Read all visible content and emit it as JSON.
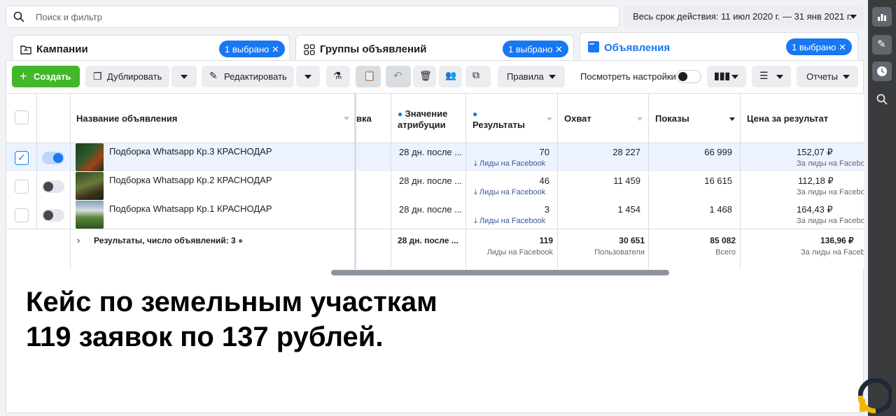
{
  "search": {
    "placeholder": "Поиск и фильтр"
  },
  "date_range": "Весь срок действия: 11 июл 2020 г. — 31 янв 2021 г.",
  "tabs": [
    {
      "label": "Кампании",
      "selected": "1 выбрано"
    },
    {
      "label": "Группы объявлений",
      "selected": "1 выбрано"
    },
    {
      "label": "Объявления",
      "selected": "1 выбрано"
    }
  ],
  "toolbar": {
    "create": "Создать",
    "duplicate": "Дублировать",
    "edit": "Редактировать",
    "rules": "Правила",
    "view_settings": "Посмотреть настройки",
    "reports": "Отчеты"
  },
  "columns": {
    "name": "Название объявления",
    "partial": "вка",
    "attribution_line1": "Значение",
    "attribution_line2": "атрибуции",
    "results": "Результаты",
    "reach": "Охват",
    "impressions": "Показы",
    "cost": "Цена за результат"
  },
  "rows": [
    {
      "name": "Подборка Whatsapp Кр.3 КРАСНОДАР",
      "attribution": "28 дн. после ...",
      "results": "70",
      "results_type": "Лиды на Facebook",
      "reach": "28 227",
      "impressions": "66 999",
      "cost": "152,07 ₽",
      "cost_type": "За лиды на Facebook",
      "checked": true,
      "active": true
    },
    {
      "name": "Подборка Whatsapp Кр.2 КРАСНОДАР",
      "attribution": "28 дн. после ...",
      "results": "46",
      "results_type": "Лиды на Facebook",
      "reach": "11 459",
      "impressions": "16 615",
      "cost": "112,18 ₽",
      "cost_type": "За лиды на Facebook",
      "checked": false,
      "active": false
    },
    {
      "name": "Подборка Whatsapp Кр.1 КРАСНОДАР",
      "attribution": "28 дн. после ...",
      "results": "3",
      "results_type": "Лиды на Facebook",
      "reach": "1 454",
      "impressions": "1 468",
      "cost": "164,43 ₽",
      "cost_type": "За лиды на Facebook",
      "checked": false,
      "active": false
    }
  ],
  "totals": {
    "label": "Результаты, число объявлений: 3",
    "attribution": "28 дн. после ...",
    "results": "119",
    "results_type": "Лиды на Facebook",
    "reach": "30 651",
    "reach_type": "Пользователи",
    "impressions": "85 082",
    "impressions_type": "Всего",
    "cost": "136,96 ₽",
    "cost_type": "За лиды на Facebook"
  },
  "headline": {
    "line1": "Кейс по земельным участкам",
    "line2": "119 заявок по 137 рублей."
  },
  "colors": {
    "accent": "#1877f2",
    "create": "#42b72a"
  }
}
